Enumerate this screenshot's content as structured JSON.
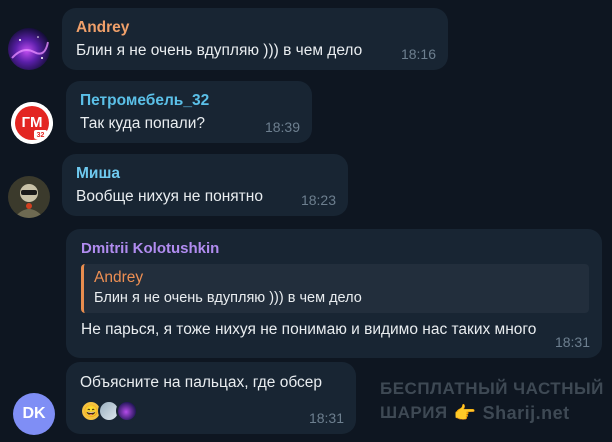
{
  "messages": [
    {
      "sender": "Andrey",
      "sender_color": "#f0a06a",
      "text": "Блин я не очень вдупляю ))) в чем дело",
      "time": "18:16",
      "avatar": "nebula-avatar"
    },
    {
      "sender": "Петромебель_32",
      "sender_color": "#5bc0e8",
      "text": "Так куда попали?",
      "time": "18:39",
      "avatar": "logo-avatar",
      "avatar_text": "ГМ",
      "avatar_subtext": "32"
    },
    {
      "sender": "Миша",
      "sender_color": "#6ec9ef",
      "text": "Вообще нихуя не понятно",
      "time": "18:23",
      "avatar": "photo-avatar"
    },
    {
      "sender": "Dmitrii Kolotushkin",
      "sender_color": "#b18cf0",
      "reply_name": "Andrey",
      "reply_text": "Блин я не очень вдупляю ))) в чем дело",
      "text": "Не парься, я тоже нихуя не понимаю и видимо нас таких много",
      "time": "18:31"
    },
    {
      "text": "Объясните на пальцах, где обсер",
      "time": "18:31",
      "avatar_initials": "DK",
      "reactions": [
        "smile-emoji",
        "user-reaction-avatar",
        "user-reaction-avatar"
      ]
    }
  ],
  "watermark": {
    "line1": "БЕСПЛАТНЫЙ ЧАСТНЫЙ",
    "line2": "ШАРИЯ",
    "site": "Sharij.net"
  },
  "colors": {
    "background": "#0e1621",
    "bubble": "#182533",
    "time": "#6d7f8f",
    "dk_avatar": "#7f8ef5"
  }
}
